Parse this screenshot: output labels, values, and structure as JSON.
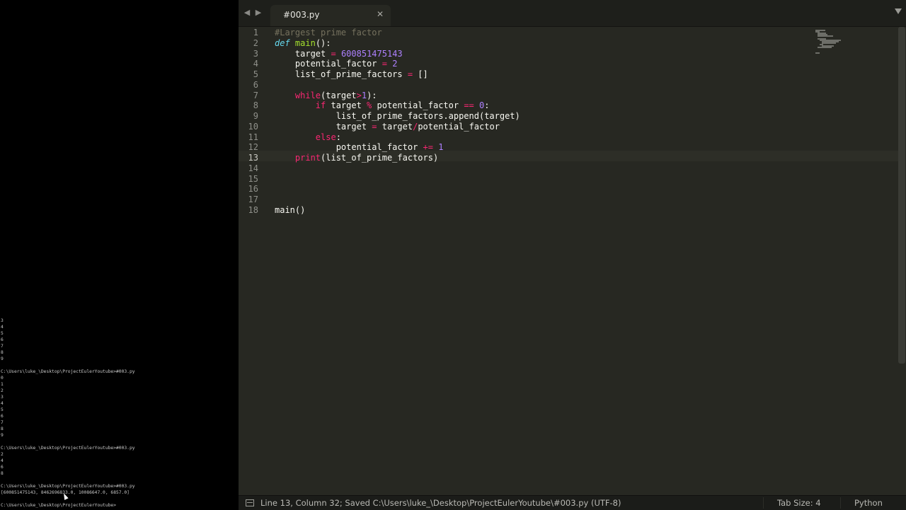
{
  "terminal": {
    "lines": [
      "3",
      "4",
      "5",
      "6",
      "7",
      "8",
      "9",
      "",
      "C:\\Users\\luke_\\Desktop\\ProjectEulerYoutube>#003.py",
      "0",
      "1",
      "2",
      "3",
      "4",
      "5",
      "6",
      "7",
      "8",
      "9",
      "",
      "C:\\Users\\luke_\\Desktop\\ProjectEulerYoutube>#003.py",
      "2",
      "4",
      "6",
      "8",
      "",
      "C:\\Users\\luke_\\Desktop\\ProjectEulerYoutube>#003.py",
      "[600851475143, 8462696833.0, 10086647.0, 6857.0]",
      "",
      "C:\\Users\\luke_\\Desktop\\ProjectEulerYoutube>"
    ]
  },
  "tabbar": {
    "back_icon": "back-arrow-icon",
    "forward_icon": "forward-arrow-icon",
    "active_tab": "#003.py",
    "close_glyph": "✕",
    "menu_icon": "tab-dropdown-icon"
  },
  "editor": {
    "line_numbers": [
      "1",
      "2",
      "3",
      "4",
      "5",
      "6",
      "7",
      "8",
      "9",
      "10",
      "11",
      "12",
      "13",
      "14",
      "15",
      "16",
      "17",
      "18"
    ],
    "current_line": 13,
    "code": [
      [
        {
          "t": "#Largest prime factor",
          "c": "cm"
        }
      ],
      [
        {
          "t": "def",
          "c": "kwi"
        },
        {
          "t": " "
        },
        {
          "t": "main",
          "c": "fn"
        },
        {
          "t": "():"
        }
      ],
      [
        {
          "t": "    target "
        },
        {
          "t": "=",
          "c": "op"
        },
        {
          "t": " "
        },
        {
          "t": "600851475143",
          "c": "num"
        }
      ],
      [
        {
          "t": "    potential_factor "
        },
        {
          "t": "=",
          "c": "op"
        },
        {
          "t": " "
        },
        {
          "t": "2",
          "c": "num"
        }
      ],
      [
        {
          "t": "    list_of_prime_factors "
        },
        {
          "t": "=",
          "c": "op"
        },
        {
          "t": " []"
        }
      ],
      [
        {
          "t": ""
        }
      ],
      [
        {
          "t": "    "
        },
        {
          "t": "while",
          "c": "kw"
        },
        {
          "t": "(target"
        },
        {
          "t": ">",
          "c": "op"
        },
        {
          "t": "1",
          "c": "num"
        },
        {
          "t": "):"
        }
      ],
      [
        {
          "t": "        "
        },
        {
          "t": "if",
          "c": "kw"
        },
        {
          "t": " target "
        },
        {
          "t": "%",
          "c": "op"
        },
        {
          "t": " potential_factor "
        },
        {
          "t": "==",
          "c": "op"
        },
        {
          "t": " "
        },
        {
          "t": "0",
          "c": "num"
        },
        {
          "t": ":"
        }
      ],
      [
        {
          "t": "            list_of_prime_factors.append(target)"
        }
      ],
      [
        {
          "t": "            target "
        },
        {
          "t": "=",
          "c": "op"
        },
        {
          "t": " target"
        },
        {
          "t": "/",
          "c": "op"
        },
        {
          "t": "potential_factor"
        }
      ],
      [
        {
          "t": "        "
        },
        {
          "t": "else",
          "c": "kw"
        },
        {
          "t": ":"
        }
      ],
      [
        {
          "t": "            potential_factor "
        },
        {
          "t": "+=",
          "c": "op"
        },
        {
          "t": " "
        },
        {
          "t": "1",
          "c": "num"
        }
      ],
      [
        {
          "t": "    "
        },
        {
          "t": "print",
          "c": "kw"
        },
        {
          "t": "(list_of_prime_factors)"
        }
      ],
      [
        {
          "t": ""
        }
      ],
      [
        {
          "t": ""
        }
      ],
      [
        {
          "t": ""
        }
      ],
      [
        {
          "t": ""
        }
      ],
      [
        {
          "t": "main()"
        }
      ]
    ]
  },
  "statusbar": {
    "icon": "panel-toggle-icon",
    "message": "Line 13, Column 32; Saved C:\\Users\\luke_\\Desktop\\ProjectEulerYoutube\\#003.py (UTF-8)",
    "tab_size": "Tab Size: 4",
    "syntax": "Python"
  },
  "colors": {
    "editor_bg": "#272822",
    "keyword": "#f92672",
    "function": "#a6e22e",
    "number": "#ae81ff",
    "comment": "#75715e",
    "def_keyword": "#66d9ef"
  }
}
